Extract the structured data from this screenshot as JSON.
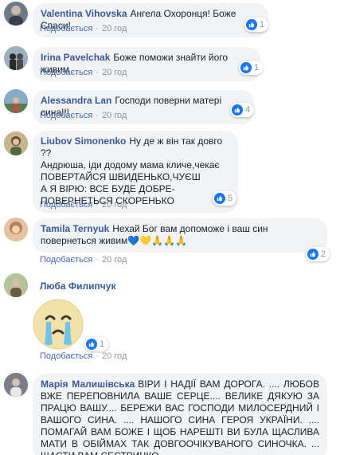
{
  "comments": [
    {
      "author": "Valentina Vihovska",
      "text": "Ангела Охоронця! Боже Спаси!",
      "like_label": "Подобається",
      "time": "20 год",
      "reactions": "1"
    },
    {
      "author": "Irina Pavelchak",
      "text": "Боже поможи знайти його живим",
      "like_label": "Подобається",
      "time": "20 год",
      "reactions": "1"
    },
    {
      "author": "Alessandra Lan",
      "text": "Господи поверни матері сина!!!",
      "like_label": "Подобається",
      "time": "20 год",
      "reactions": "4"
    },
    {
      "author": "Liubov Simonenko",
      "text": "Ну де ж він так довго ??\nАндрюша, іди додому мама кличе,чекає\nПОВЕРТАЙСЯ ШВИДЕНЬКО,ЧУЄШ\nА Я ВІРЮ: ВСЕ БУДЕ ДОБРЕ-\nПОВЕРНЕТЬСЯ СКОРЕНЬКО",
      "like_label": "Подобається",
      "time": "20 год",
      "reactions": "5"
    },
    {
      "author": "Tamila Ternyuk",
      "text": "Нехай Бог вам допоможе і ваш син повернеться живим💙💛🙏🙏🙏",
      "like_label": "Подобається",
      "time": "20 год",
      "reactions": "2"
    },
    {
      "author": "Люба Филипчук",
      "text": "",
      "like_label": "Подобається",
      "time": "20 год",
      "reactions": "1"
    },
    {
      "author": "Марія Малишівська",
      "text": "ВІРИ І НАДІЇ ВАМ ДОРОГА. .... ЛЮБОВ ВЖЕ ПЕРЕПОВНИЛА ВАШЕ СЕРЦЕ.... ВЕЛИКЕ ДЯКУЮ ЗА ПРАЦЮ ВАШУ.... БЕРЕЖИ ВАС ГОСПОДИ МИЛОСЕРДНИЙ І ВАШОГО СИНА. .... НАШОГО СИНА ГЕРОЯ УКРАЇНИ. .... ПОМАГАЙ ВАМ БОЖЕ І ЩОБ НАРЕШТІ ВИ БУЛА ЩАСЛИВА МАТИ В ОБІЙМАХ ТАК ДОВГООЧІКУВАНОГО СИНОЧКА. ... ЩАСТИ ВАМ СЕСТРИЧКО. ....",
      "like_label": "",
      "time": "",
      "reactions": ""
    }
  ],
  "colors": {
    "author": "#385898",
    "bubble": "#f2f3f5",
    "like_blue": "#1877f2"
  }
}
